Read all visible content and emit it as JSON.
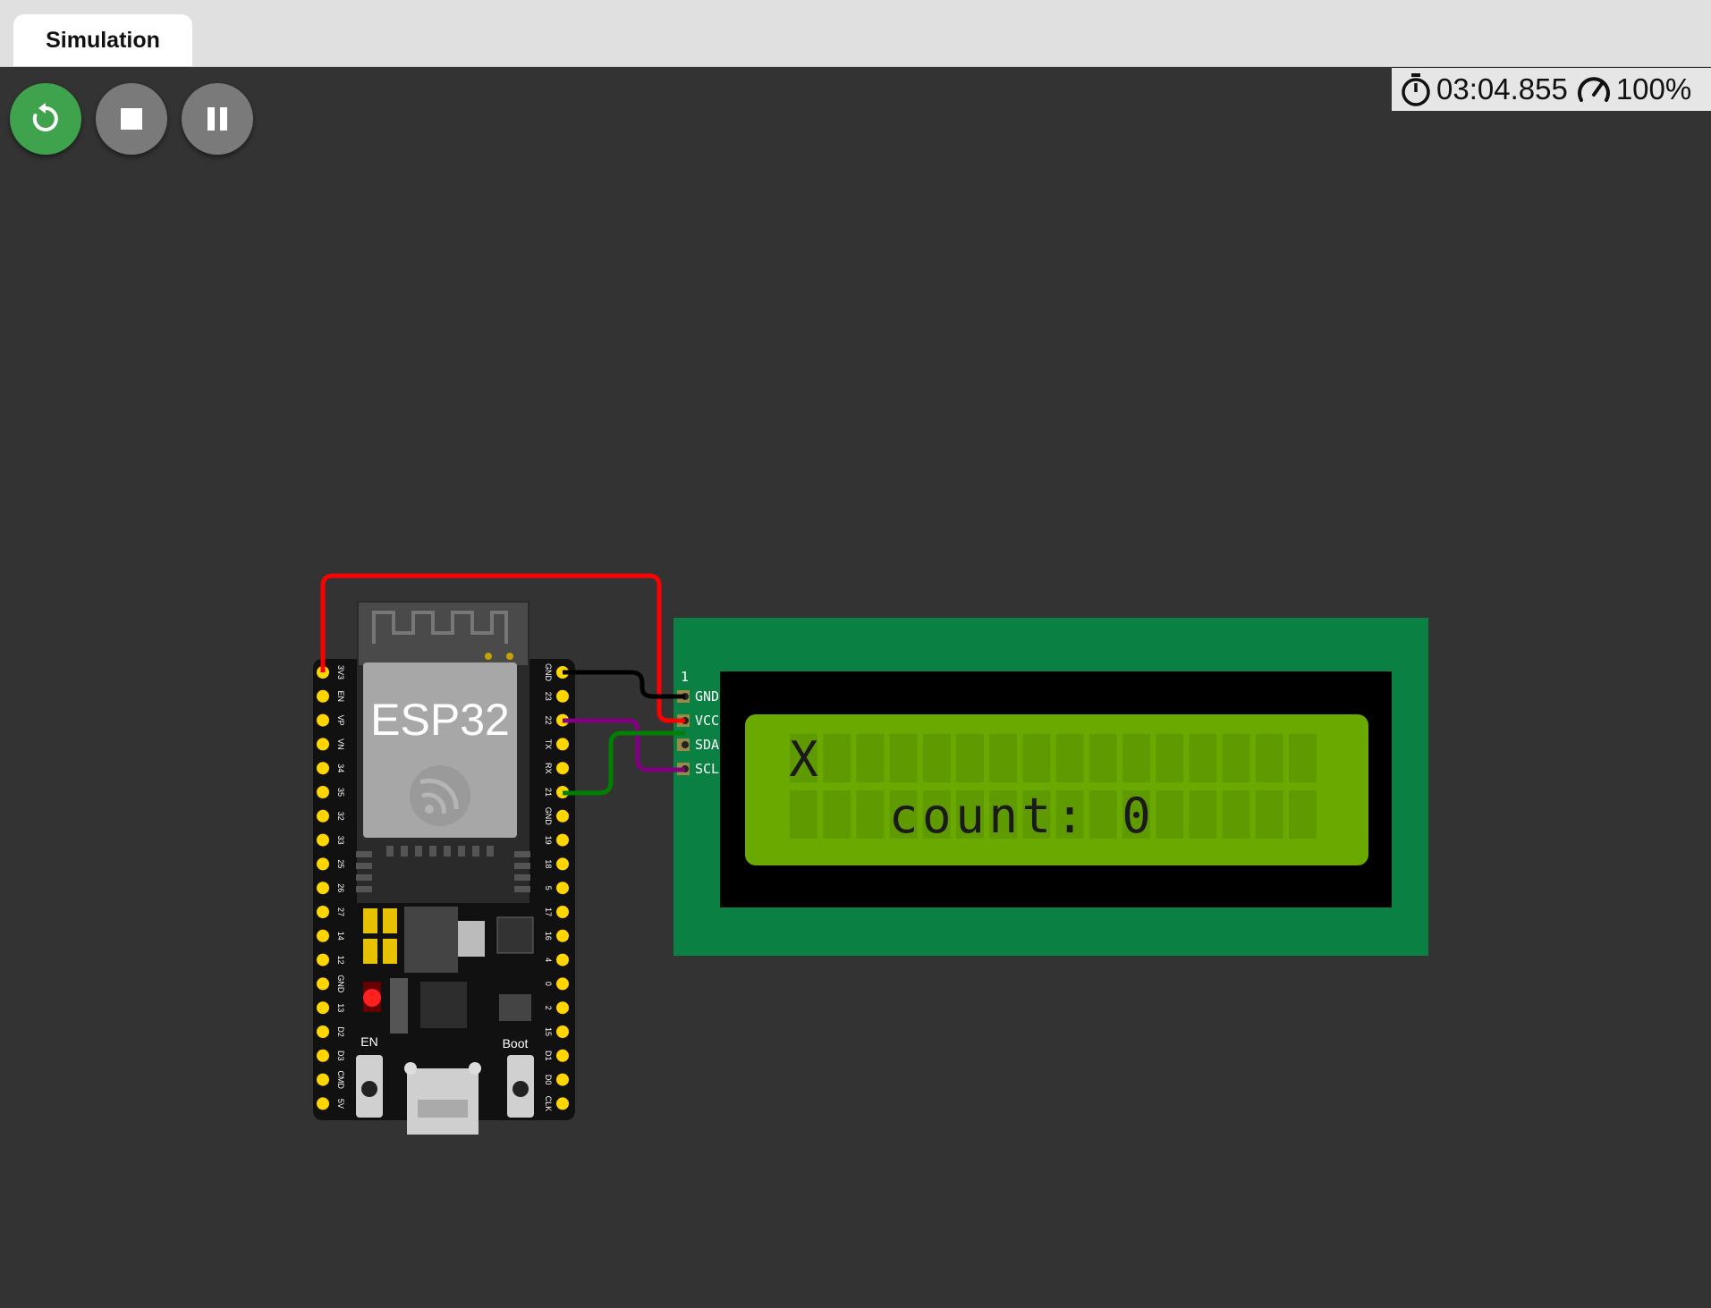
{
  "tabs": [
    {
      "label": "Simulation"
    }
  ],
  "toolbar": {
    "restart_icon": "restart-icon",
    "stop_icon": "stop-icon",
    "pause_icon": "pause-icon"
  },
  "status": {
    "elapsed_time": "03:04.855",
    "speed": "100%"
  },
  "esp32": {
    "chip_label": "ESP32",
    "left_pins": [
      "3V3",
      "EN",
      "VP",
      "VN",
      "34",
      "35",
      "32",
      "33",
      "25",
      "26",
      "27",
      "14",
      "12",
      "GND",
      "13",
      "D2",
      "D3",
      "CMD",
      "5V"
    ],
    "right_pins": [
      "GND",
      "23",
      "22",
      "TX",
      "RX",
      "21",
      "GND",
      "19",
      "18",
      "5",
      "17",
      "16",
      "4",
      "0",
      "2",
      "15",
      "D1",
      "D0",
      "CLK"
    ],
    "en_button_label": "EN",
    "boot_button_label": "Boot"
  },
  "lcd": {
    "pin_number": "1",
    "pins": [
      "GND",
      "VCC",
      "SDA",
      "SCL"
    ],
    "line1": "X",
    "line2": "   count: 0",
    "colors": {
      "pcb": "#0b8043",
      "screen": "#6aaa00",
      "text": "#1a1a1a"
    }
  },
  "wires": [
    {
      "from": "3V3",
      "to": "VCC",
      "color": "#ff0000"
    },
    {
      "from": "GND",
      "to": "GND",
      "color": "#000000"
    },
    {
      "from": "22",
      "to": "SCL",
      "color": "#800080"
    },
    {
      "from": "21",
      "to": "SDA",
      "color": "#008000"
    }
  ]
}
